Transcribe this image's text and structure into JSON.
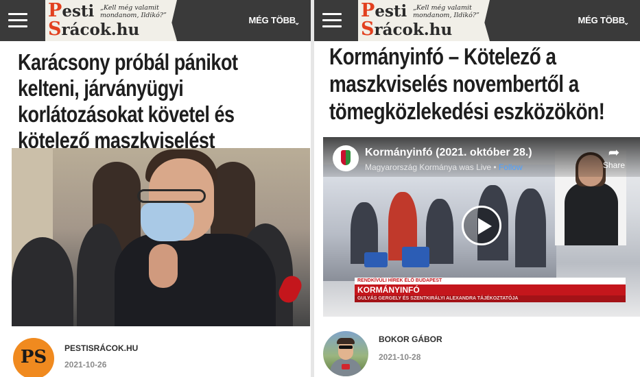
{
  "left": {
    "logo": {
      "line1_cap": "P",
      "line1_rest": "esti",
      "line2_cap": "S",
      "line2_rest": "rácok.hu",
      "tagline": "„Kell még valamit mondanom, Ildikó?”"
    },
    "more_label": "MÉG TÖBB",
    "headline": "Karácsony próbál pánikot kelteni, járványügyi korlátozásokat követel és kötelező maszkviselést",
    "author_avatar_text": "PS",
    "author": "PESTISRÁCOK.HU",
    "date": "2021-10-26"
  },
  "right": {
    "logo": {
      "line1_cap": "P",
      "line1_rest": "esti",
      "line2_cap": "S",
      "line2_rest": "rácok.hu",
      "tagline": "„Kell még valamit mondanom, Ildikó?”"
    },
    "more_label": "MÉG TÖBB",
    "headline": "Kormányinfó – Kötelező a maszkviselés novembertől a tömegközlekedési eszközökön!",
    "video": {
      "title": "Kormányinfó (2021. október 28.)",
      "subtitle": "Magyarország Kormánya was Live",
      "separator": " • ",
      "follow_label": "Follow",
      "share_label": "Share",
      "ticker_top": "RENDKÍVÜLI HÍREK  ÉLŐ  BUDAPEST",
      "ticker_main": "KORMÁNYINFÓ",
      "ticker_sub": "GULYÁS GERGELY ÉS SZENTKIRÁLYI ALEXANDRA TÁJÉKOZTATÓJA"
    },
    "author": "BOKOR GÁBOR",
    "date": "2021-10-28"
  },
  "icons": {
    "menu": "hamburger-icon",
    "more": "chevron-down-icon",
    "play": "play-icon",
    "share": "share-arrow-icon"
  },
  "colors": {
    "header_bg": "#3a3a3a",
    "logo_accent": "#e2401f",
    "ticker_red": "#c4161c",
    "author_avatar_bg": "#f08a1f"
  }
}
